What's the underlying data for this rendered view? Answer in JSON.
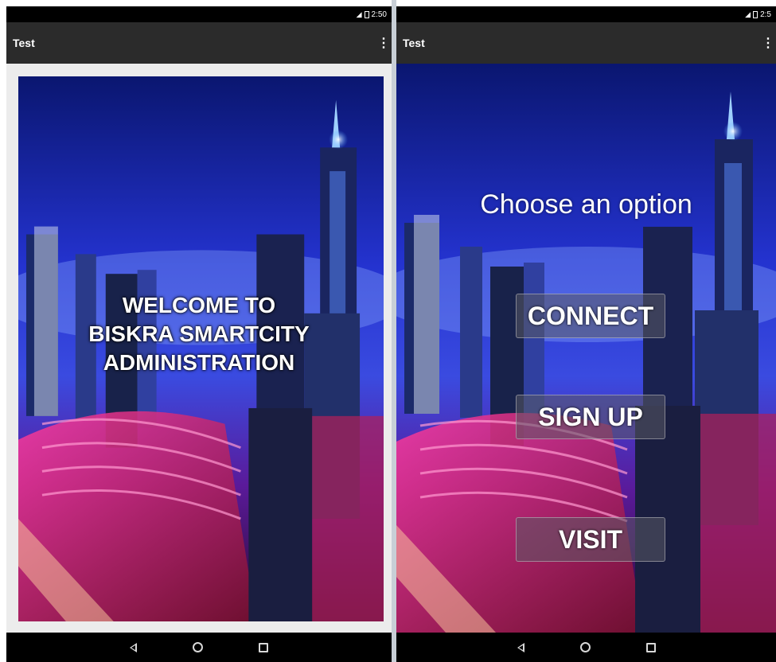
{
  "left_screen": {
    "status_time": "2:50",
    "app_title": "Test",
    "welcome_lines": [
      "WELCOME TO",
      "BISKRA SMARTCITY",
      "ADMINISTRATION"
    ]
  },
  "right_screen": {
    "status_time": "2:5",
    "app_title": "Test",
    "heading": "Choose an option",
    "buttons": {
      "connect": "CONNECT",
      "signup": "SIGN UP",
      "visit": "VISIT"
    }
  },
  "icons": {
    "overflow": "overflow-menu-icon",
    "signal": "signal-icon",
    "battery": "battery-icon",
    "back": "back-icon",
    "home": "home-icon",
    "recents": "recents-icon"
  },
  "colors": {
    "app_bar": "#2b2b2b",
    "status_bar": "#000000",
    "sky_top": "#0a1a8a",
    "sky_mid": "#2a3fd8",
    "neon_pink": "#ff2a8a"
  }
}
